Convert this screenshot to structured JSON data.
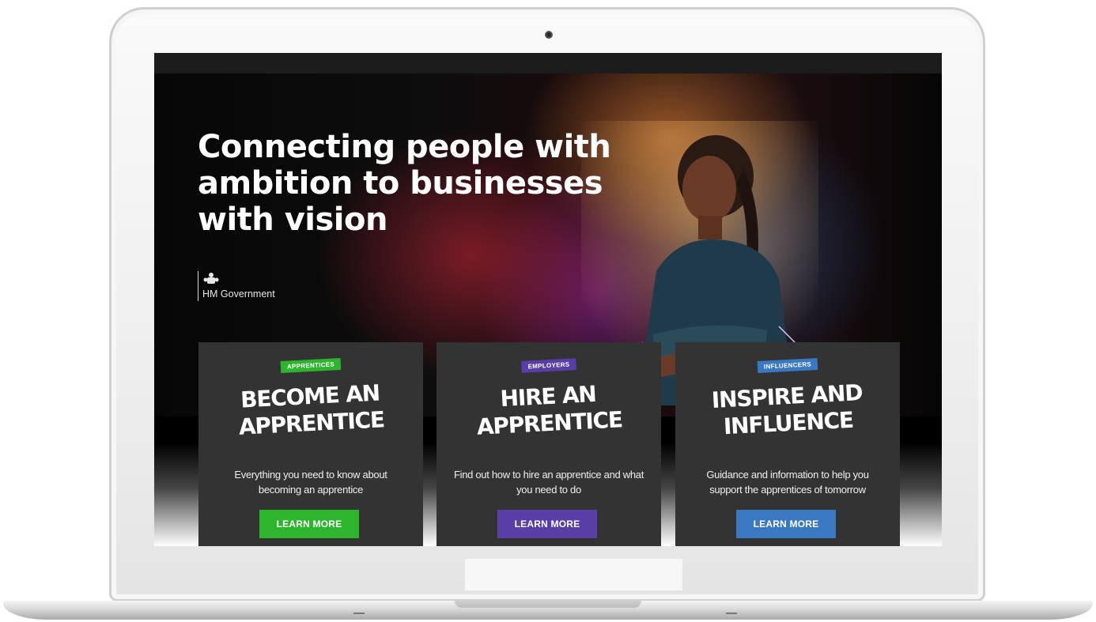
{
  "hero": {
    "headline": "Connecting people with ambition to businesses with vision",
    "gov_label": "HM Government"
  },
  "cards": [
    {
      "tag": "APPRENTICES",
      "title": "BECOME AN APPRENTICE",
      "description": "Everything you need to know about becoming an apprentice",
      "button": "LEARN MORE",
      "accent": "#2db52d"
    },
    {
      "tag": "EMPLOYERS",
      "title": "HIRE AN APPRENTICE",
      "description": "Find out how to hire an apprentice and what you need to do",
      "button": "LEARN MORE",
      "accent": "#5a3ea8"
    },
    {
      "tag": "INFLUENCERS",
      "title": "INSPIRE AND INFLUENCE",
      "description": "Guidance and information to help you support the apprentices of tomorrow",
      "button": "LEARN MORE",
      "accent": "#3a78c2"
    }
  ],
  "icons": {
    "gov_crest": "royal-crest-icon",
    "camera": "camera-icon"
  }
}
